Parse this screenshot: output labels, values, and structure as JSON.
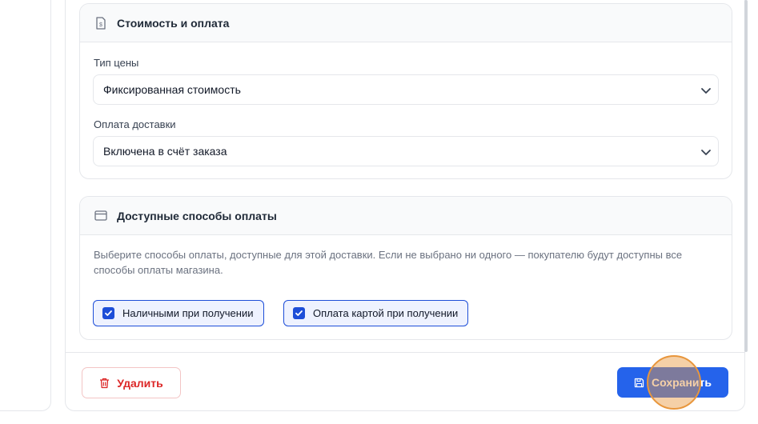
{
  "pricing_card": {
    "title": "Стоимость и оплата",
    "price_type": {
      "label": "Тип цены",
      "value": "Фиксированная стоимость"
    },
    "delivery_payment": {
      "label": "Оплата доставки",
      "value": "Включена в счёт заказа"
    }
  },
  "payment_methods_card": {
    "title": "Доступные способы оплаты",
    "description": "Выберите способы оплаты, доступные для этой доставки. Если не выбрано ни одного — покупателю будут доступны все способы оплаты магазина.",
    "options": [
      {
        "label": "Наличными при получении",
        "checked": true
      },
      {
        "label": "Оплата картой при получении",
        "checked": true
      }
    ]
  },
  "footer": {
    "delete_label": "Удалить",
    "save_label": "Сохранить"
  },
  "icons": {
    "pricing": "document-dollar-icon",
    "payment": "credit-card-icon",
    "select": "chevron-down-icon",
    "delete": "trash-icon",
    "save": "floppy-disk-icon"
  },
  "colors": {
    "primary": "#2563eb",
    "danger": "#dc2626",
    "checkbox": "#1d4ed8",
    "chip_bg": "#eef2ff"
  }
}
